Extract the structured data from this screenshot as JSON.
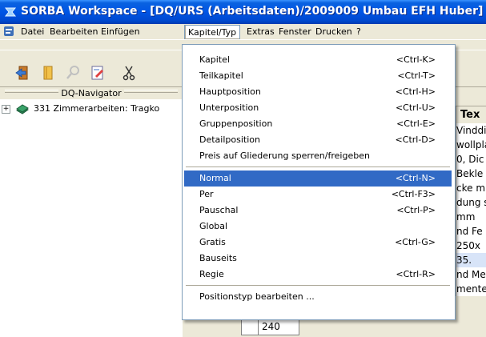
{
  "window": {
    "title": "SORBA Workspace - [DQ/URS (Arbeitsdaten)/2009009 Umbau EFH Huber]",
    "title_color": "#0055e5"
  },
  "menubar": {
    "items": [
      {
        "label": "Datei"
      },
      {
        "label": "Bearbeiten"
      },
      {
        "label": "Einfügen"
      },
      {
        "label": "Kapitel/Typ"
      },
      {
        "label": "Extras"
      },
      {
        "label": "Fenster"
      },
      {
        "label": "Drucken"
      },
      {
        "label": "?"
      }
    ]
  },
  "toolbar": {
    "icons": [
      "exit-icon",
      "book-icon",
      "search-icon",
      "edit-icon",
      "cut-icon"
    ]
  },
  "navigator": {
    "title": "DQ-Navigator",
    "tree": [
      {
        "expander": "+",
        "label": "331 Zimmerarbeiten: Tragko"
      }
    ]
  },
  "content": {
    "column_header": "Tex",
    "lines": [
      "Vinddi",
      "wollpla",
      "0, Dic",
      "Bekle",
      "cke m",
      "dung s",
      "mm",
      "nd Fe",
      "250x",
      "35.",
      "nd Me",
      "mente"
    ],
    "row_number": "240"
  },
  "dropdown": {
    "menu_title": "Kapitel/Typ",
    "groups": [
      [
        {
          "label": "Kapitel",
          "shortcut": "<Ctrl-K>"
        },
        {
          "label": "Teilkapitel",
          "shortcut": "<Ctrl-T>"
        },
        {
          "label": "Hauptposition",
          "shortcut": "<Ctrl-H>"
        },
        {
          "label": "Unterposition",
          "shortcut": "<Ctrl-U>"
        },
        {
          "label": "Gruppenposition",
          "shortcut": "<Ctrl-E>"
        },
        {
          "label": "Detailposition",
          "shortcut": "<Ctrl-D>"
        },
        {
          "label": "Preis auf Gliederung sperren/freigeben",
          "shortcut": ""
        }
      ],
      [
        {
          "label": "Normal",
          "shortcut": "<Ctrl-N>",
          "highlighted": true
        },
        {
          "label": "Per",
          "shortcut": "<Ctrl-F3>"
        },
        {
          "label": "Pauschal",
          "shortcut": "<Ctrl-P>"
        },
        {
          "label": "Global",
          "shortcut": ""
        },
        {
          "label": "Gratis",
          "shortcut": "<Ctrl-G>"
        },
        {
          "label": "Bauseits",
          "shortcut": ""
        },
        {
          "label": "Regie",
          "shortcut": "<Ctrl-R>"
        }
      ],
      [
        {
          "label": "Positionstyp bearbeiten ...",
          "shortcut": ""
        }
      ]
    ],
    "highlight_color": "#316ac5"
  }
}
